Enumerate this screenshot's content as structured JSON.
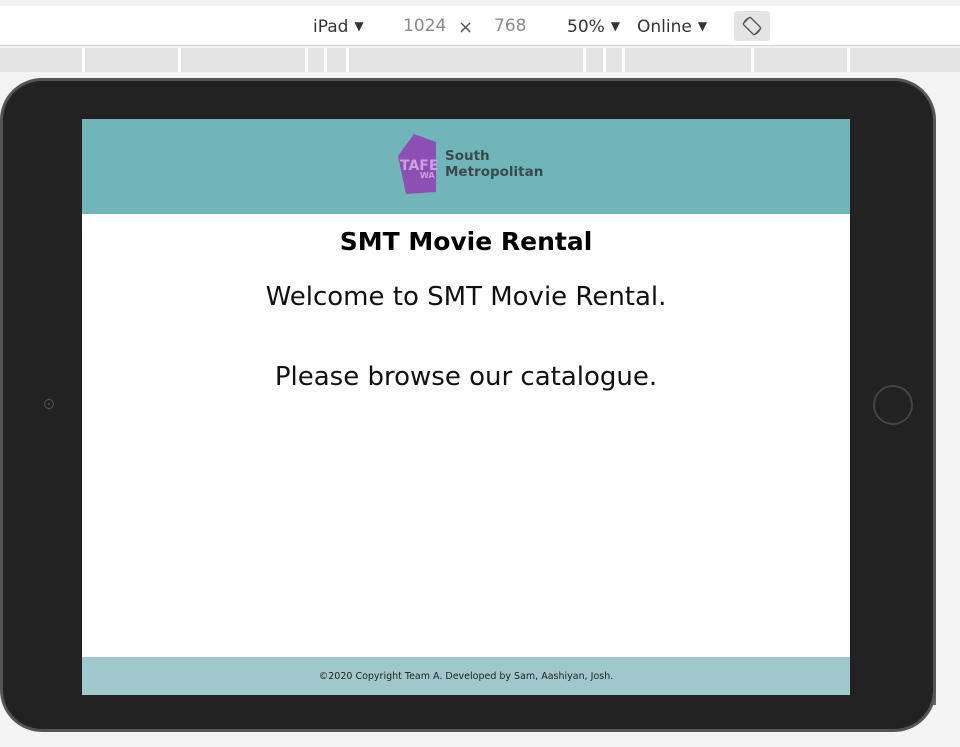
{
  "toolbar": {
    "device": "iPad",
    "width": "1024",
    "times": "×",
    "height": "768",
    "zoom": "50%",
    "throttle": "Online",
    "rotate_icon": "rotate-device-icon"
  },
  "site": {
    "logo": {
      "mark_text": "TAFE",
      "mark_subtext": "WA",
      "line1": "South",
      "line2": "Metropolitan"
    },
    "title": "SMT Movie Rental",
    "welcome": "Welcome to SMT Movie Rental.",
    "browse": "Please browse our catalogue.",
    "footer": "©2020 Copyright Team A. Developed by Sam, Aashiyan, Josh."
  },
  "colors": {
    "header_bg": "#70b6b9",
    "footer_bg": "#a0c8cc",
    "logo_purple": "#8e4fb4",
    "ipad_frame": "#222222"
  }
}
